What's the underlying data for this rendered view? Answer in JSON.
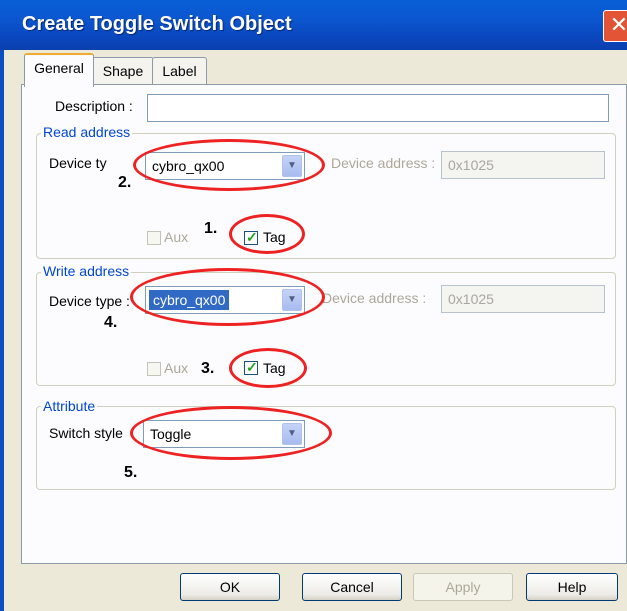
{
  "window": {
    "title": "Create Toggle Switch Object",
    "close_label": "✕"
  },
  "tabs": [
    {
      "label": "General"
    },
    {
      "label": "Shape"
    },
    {
      "label": "Label"
    }
  ],
  "general": {
    "description_label": "Description :",
    "description_value": ""
  },
  "read_address": {
    "group_label": "Read address",
    "device_type_label": "Device ty",
    "device_type_value": "cybro_qx00",
    "device_address_label": "Device address :",
    "device_address_value": "0x1025",
    "aux_label": "Aux",
    "tag_label": "Tag",
    "tag_checked": true
  },
  "write_address": {
    "group_label": "Write address",
    "device_type_label": "Device type :",
    "device_type_value": "cybro_qx00",
    "device_address_label": "Device  address :",
    "device_address_value": "0x1025",
    "aux_label": "Aux",
    "tag_label": "Tag",
    "tag_checked": true
  },
  "attribute": {
    "group_label": "Attribute",
    "switch_style_label": "Switch style",
    "switch_style_value": "Toggle"
  },
  "annotations": {
    "n1": "1.",
    "n2": "2.",
    "n3": "3.",
    "n4": "4.",
    "n5": "5."
  },
  "buttons": {
    "ok": "OK",
    "cancel": "Cancel",
    "apply": "Apply",
    "help": "Help"
  },
  "colors": {
    "annotation_oval": "#ee2222",
    "group_label": "#0046d5",
    "titlebar": "#0a5fd6"
  }
}
